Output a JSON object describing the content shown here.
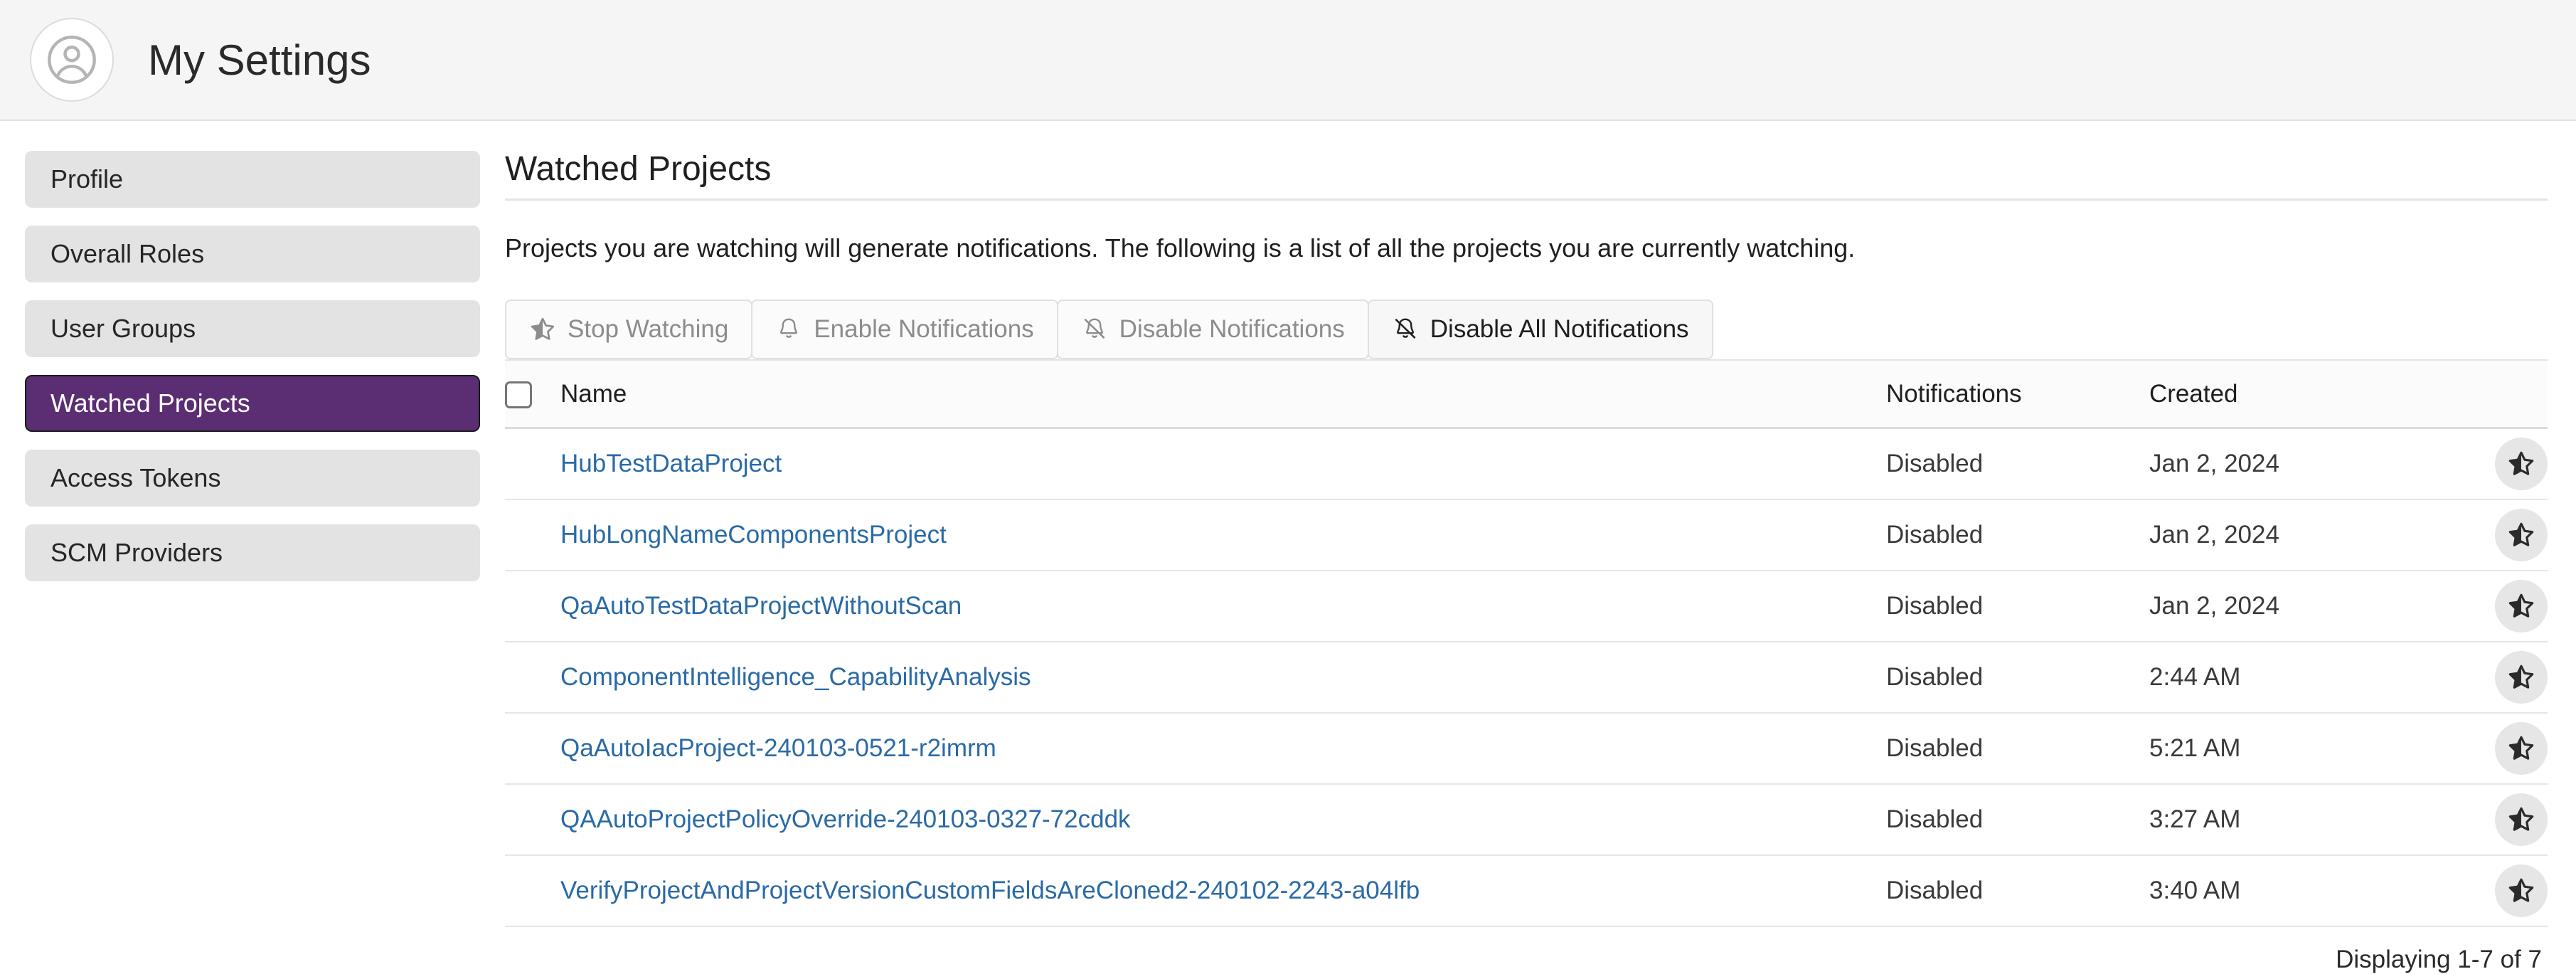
{
  "header": {
    "title": "My Settings",
    "avatar_icon": "user-avatar-icon"
  },
  "sidebar": {
    "items": [
      {
        "label": "Profile",
        "selected": false
      },
      {
        "label": "Overall Roles",
        "selected": false
      },
      {
        "label": "User Groups",
        "selected": false
      },
      {
        "label": "Watched Projects",
        "selected": true
      },
      {
        "label": "Access Tokens",
        "selected": false
      },
      {
        "label": "SCM Providers",
        "selected": false
      }
    ],
    "selected_color": "#5b2d72"
  },
  "main": {
    "section_title": "Watched Projects",
    "section_desc": "Projects you are watching will generate notifications. The following is a list of all the projects you are currently watching.",
    "toolbar": [
      {
        "label": "Stop Watching",
        "icon": "star-half-icon",
        "enabled": false
      },
      {
        "label": "Enable Notifications",
        "icon": "bell-icon",
        "enabled": false
      },
      {
        "label": "Disable Notifications",
        "icon": "bell-slash-icon",
        "enabled": false
      },
      {
        "label": "Disable All Notifications",
        "icon": "bell-slash-icon",
        "enabled": true
      }
    ],
    "table": {
      "columns": [
        "Name",
        "Notifications",
        "Created"
      ],
      "select_all_checked": false,
      "rows": [
        {
          "name": "HubTestDataProject",
          "notifications": "Disabled",
          "created": "Jan 2, 2024",
          "watch_icon": "star-half-icon"
        },
        {
          "name": "HubLongNameComponentsProject",
          "notifications": "Disabled",
          "created": "Jan 2, 2024",
          "watch_icon": "star-half-icon"
        },
        {
          "name": "QaAutoTestDataProjectWithoutScan",
          "notifications": "Disabled",
          "created": "Jan 2, 2024",
          "watch_icon": "star-half-icon"
        },
        {
          "name": "ComponentIntelligence_CapabilityAnalysis",
          "notifications": "Disabled",
          "created": "2:44 AM",
          "watch_icon": "star-half-icon"
        },
        {
          "name": "QaAutoIacProject-240103-0521-r2imrm",
          "notifications": "Disabled",
          "created": "5:21 AM",
          "watch_icon": "star-half-icon"
        },
        {
          "name": "QAAutoProjectPolicyOverride-240103-0327-72cddk",
          "notifications": "Disabled",
          "created": "3:27 AM",
          "watch_icon": "star-half-icon"
        },
        {
          "name": "VerifyProjectAndProjectVersionCustomFieldsAreCloned2-240102-2243-a04lfb",
          "notifications": "Disabled",
          "created": "3:40 AM",
          "watch_icon": "star-half-icon"
        }
      ]
    },
    "pager_text": "Displaying 1-7 of 7"
  },
  "colors": {
    "accent_purple": "#5b2d72",
    "link_blue": "#2a6aa6",
    "header_bg": "#f5f5f5",
    "nav_bg": "#e3e3e3"
  }
}
